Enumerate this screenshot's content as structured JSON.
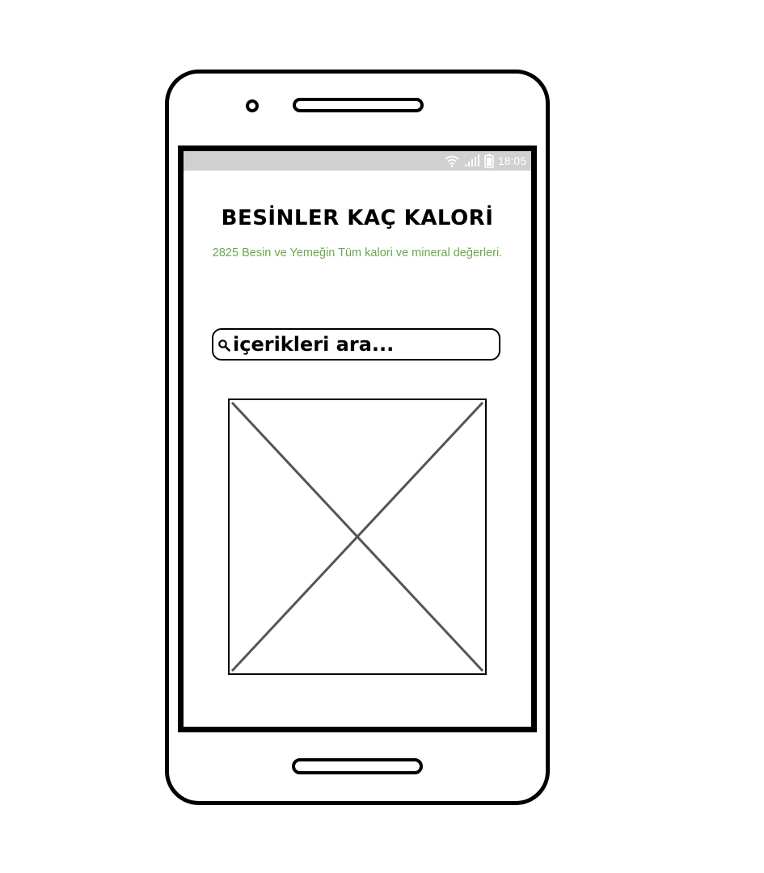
{
  "status_bar": {
    "time": "18:05",
    "icons": [
      "wifi-icon",
      "signal-icon",
      "battery-icon"
    ]
  },
  "app": {
    "title": "BESİNLER KAÇ KALORİ",
    "subtitle": "2825 Besin ve Yemeğin Tüm kalori ve mineral değerleri."
  },
  "search": {
    "placeholder": "içerikleri ara...",
    "value": "",
    "icon": "search-icon"
  },
  "image": {
    "icon": "image-placeholder-icon"
  },
  "colors": {
    "subtitle": "#6aa84f",
    "status_bar": "#d0d0d0",
    "frame": "#000000"
  }
}
